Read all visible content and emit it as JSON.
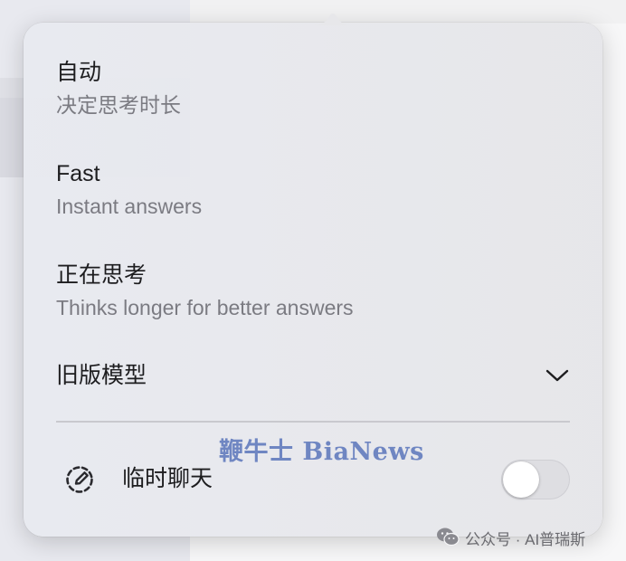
{
  "menu": {
    "options": [
      {
        "title": "自动",
        "subtitle": "决定思考时长"
      },
      {
        "title": "Fast",
        "subtitle": "Instant answers"
      },
      {
        "title": "正在思考",
        "subtitle": "Thinks longer for better answers"
      }
    ],
    "legacy_label": "旧版模型",
    "temporary_chat": {
      "label": "临时聊天",
      "enabled": false,
      "icon": "dashed-bubble-pen-icon"
    }
  },
  "watermark": "鞭牛士 BiaNews",
  "credit": "公众号 · AI普瑞斯",
  "icons": {
    "legacy_toggle": "chevron-down-icon",
    "credit": "wechat-icon"
  }
}
